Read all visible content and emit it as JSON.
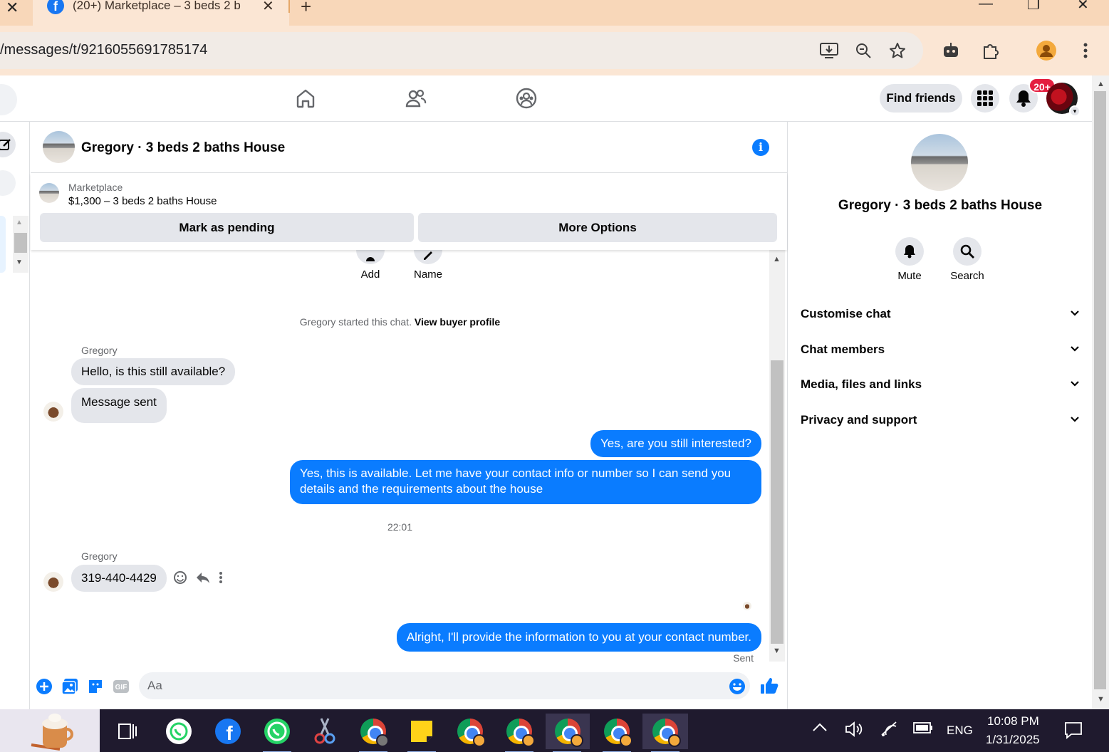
{
  "browser": {
    "tab_title": "(20+) Marketplace – 3 beds 2 b",
    "url": "/messages/t/9216055691785174"
  },
  "fbnav": {
    "find_friends": "Find friends",
    "notif_count": "20+"
  },
  "chat": {
    "header_title": "Gregory · 3 beds 2 baths House",
    "marketplace_label": "Marketplace",
    "listing": "$1,300 – 3 beds 2 baths House",
    "mark_pending": "Mark as pending",
    "more_options": "More Options",
    "actions": [
      {
        "label": "Add"
      },
      {
        "label": "Name"
      }
    ],
    "started_text": "Gregory started this chat.",
    "view_buyer": "View buyer profile",
    "messages": {
      "sender1": "Gregory",
      "in1": "Hello, is this still available?",
      "in2": "Message sent",
      "out1": "Yes, are you still interested?",
      "out2": "Yes, this is available. Let me have your contact info or number so I can send you details and the requirements about the house",
      "timestamp": "22:01",
      "sender2": "Gregory",
      "in3": "319-440-4429",
      "out3": "Alright, I'll provide the information to you at your contact number.",
      "status": "Sent"
    },
    "composer_placeholder": "Aa"
  },
  "info_panel": {
    "name": "Gregory · 3 beds 2 baths House",
    "mute": "Mute",
    "search": "Search",
    "sections": [
      "Customise chat",
      "Chat members",
      "Media, files and links",
      "Privacy and support"
    ]
  },
  "taskbar": {
    "language": "ENG",
    "time": "10:08 PM",
    "date": "1/31/2025"
  },
  "colors": {
    "messenger_blue": "#0a7cff",
    "badge_red": "#e41e3f",
    "chrome_frame": "#f8d7b9"
  }
}
